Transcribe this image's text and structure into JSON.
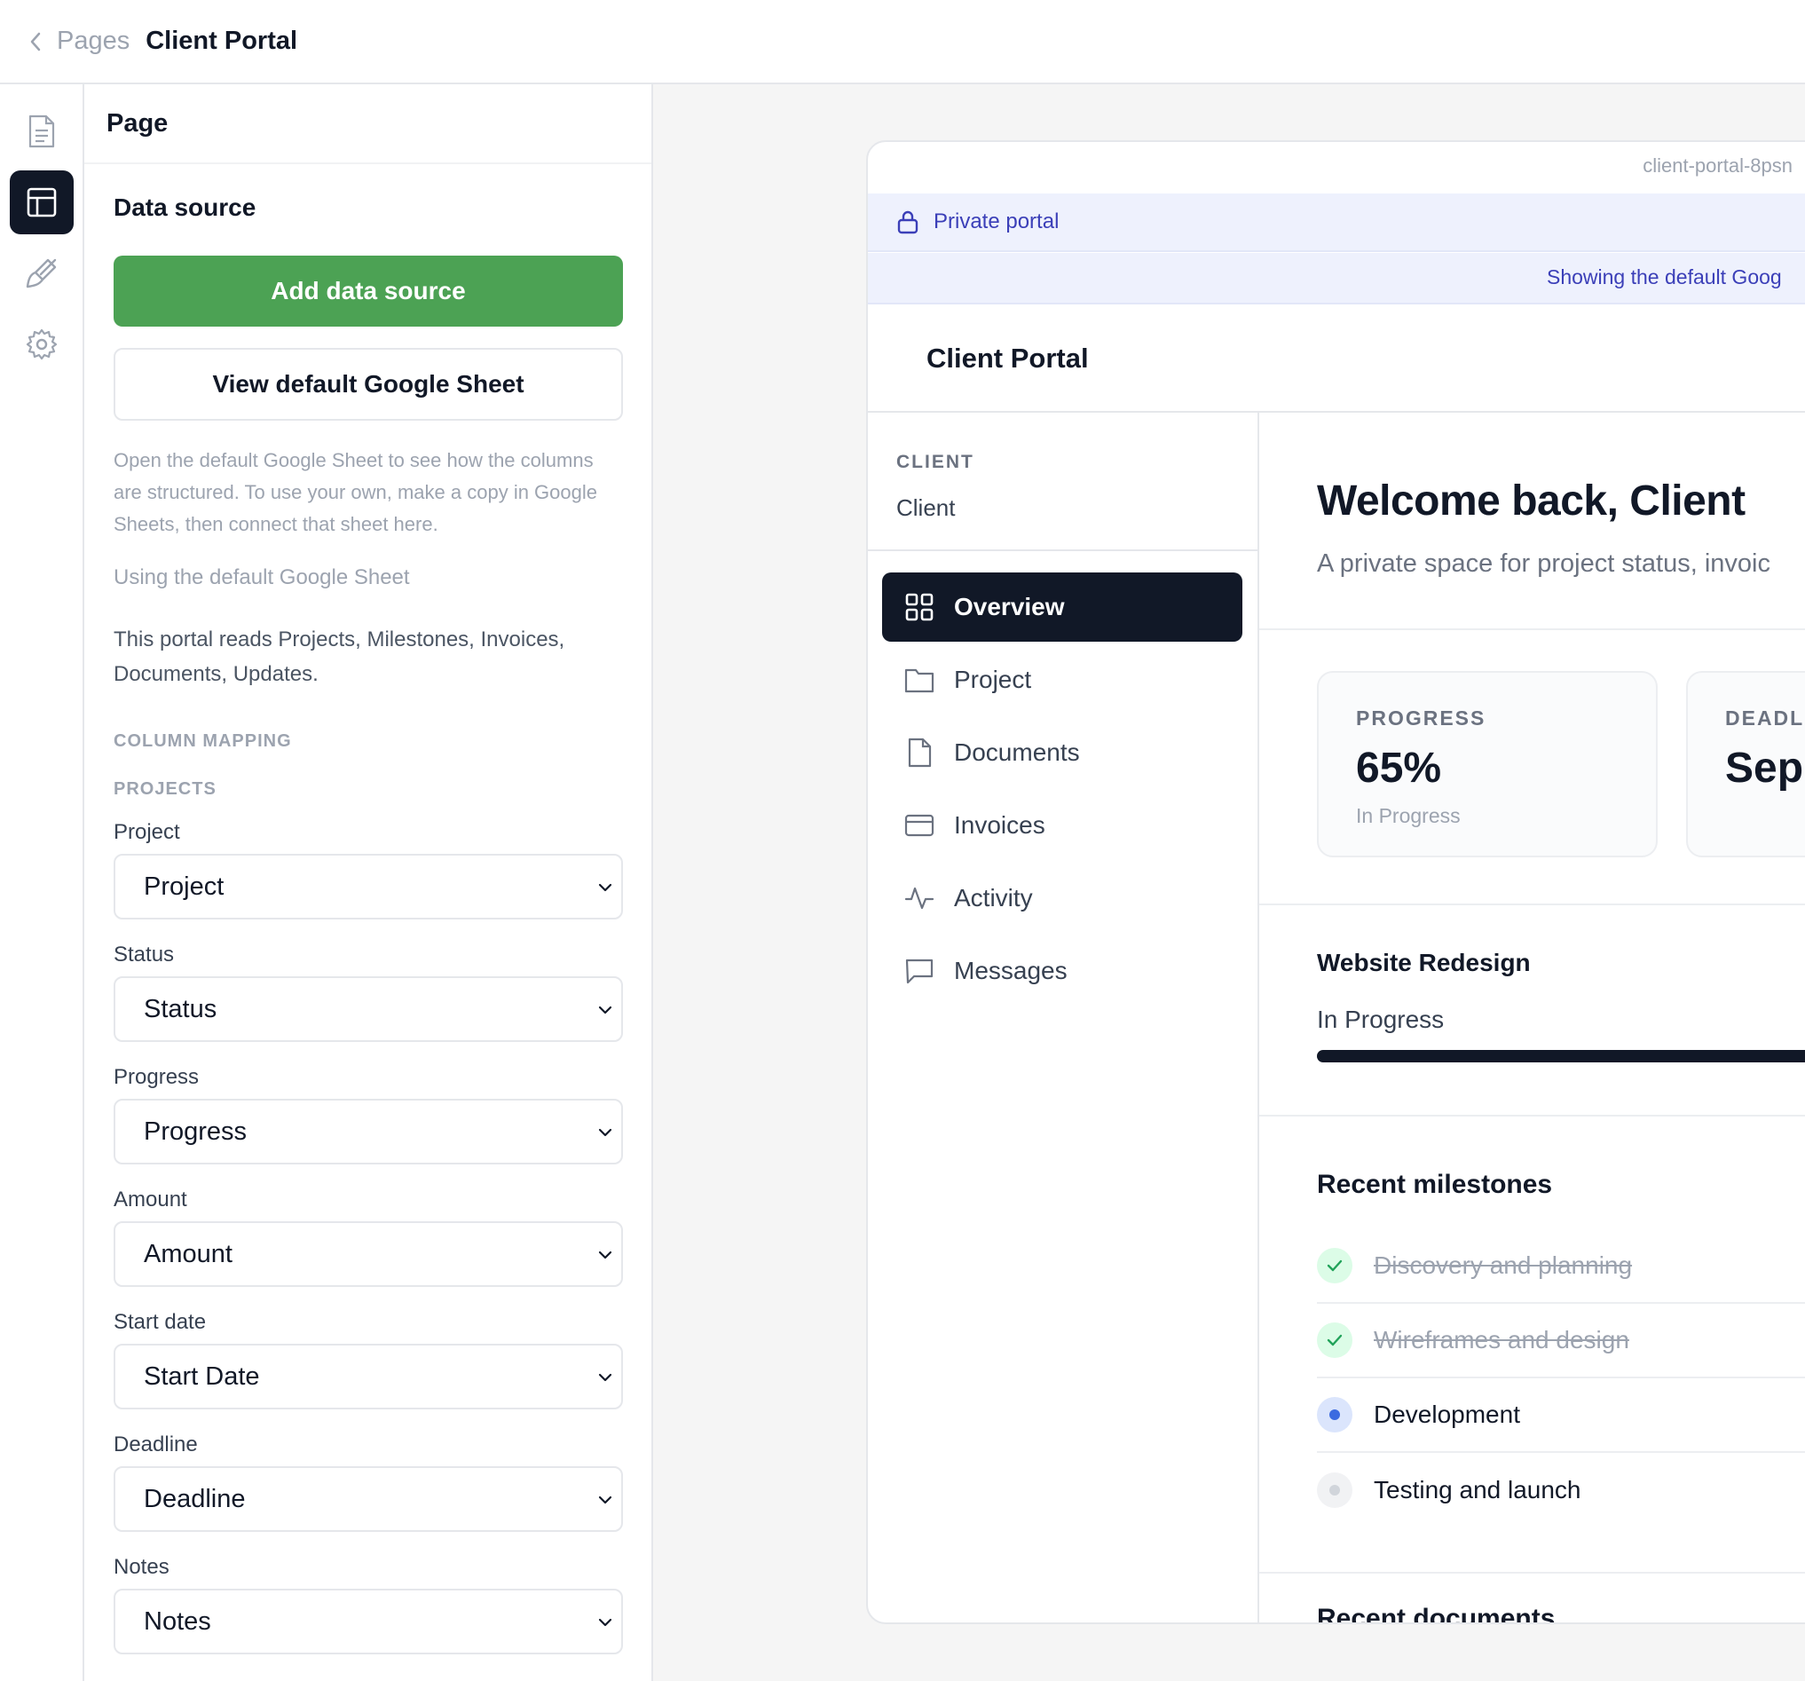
{
  "topbar": {
    "crumb": "Pages",
    "title": "Client Portal"
  },
  "rail": {
    "items": [
      "page-icon",
      "layout-icon",
      "brush-icon",
      "gear-icon"
    ],
    "active": 1
  },
  "panel": {
    "title": "Page",
    "section_title": "Data source",
    "add_button": "Add data source",
    "view_button": "View default Google Sheet",
    "help": "Open the default Google Sheet to see how the columns are structured. To use your own, make a copy in Google Sheets, then connect that sheet here.",
    "using": "Using the default Google Sheet",
    "reads": "This portal reads Projects, Milestones, Invoices, Documents, Updates.",
    "column_mapping": "COLUMN MAPPING",
    "projects_heading": "PROJECTS",
    "fields": [
      {
        "label": "Project",
        "value": "Project"
      },
      {
        "label": "Status",
        "value": "Status"
      },
      {
        "label": "Progress",
        "value": "Progress"
      },
      {
        "label": "Amount",
        "value": "Amount"
      },
      {
        "label": "Start date",
        "value": "Start Date"
      },
      {
        "label": "Deadline",
        "value": "Deadline"
      },
      {
        "label": "Notes",
        "value": "Notes"
      }
    ]
  },
  "preview": {
    "slug": "client-portal-8psn",
    "private_label": "Private portal",
    "info": "Showing the default Goog",
    "header_title": "Client Portal",
    "client_caption": "CLIENT",
    "client_value": "Client",
    "nav": [
      {
        "label": "Overview",
        "icon": "grid-icon"
      },
      {
        "label": "Project",
        "icon": "folder-icon"
      },
      {
        "label": "Documents",
        "icon": "document-icon"
      },
      {
        "label": "Invoices",
        "icon": "card-icon"
      },
      {
        "label": "Activity",
        "icon": "activity-icon"
      },
      {
        "label": "Messages",
        "icon": "message-icon"
      }
    ],
    "welcome": "Welcome back, Client",
    "subtitle": "A private space for project status, invoic",
    "cards": [
      {
        "caption": "PROGRESS",
        "value": "65%",
        "note": "In Progress"
      },
      {
        "caption": "DEADLI",
        "value": "Sep",
        "note": ""
      }
    ],
    "project_title": "Website Redesign",
    "project_status": "In Progress",
    "milestones_title": "Recent milestones",
    "milestones": [
      {
        "label": "Discovery and planning",
        "state": "done"
      },
      {
        "label": "Wireframes and design",
        "state": "done"
      },
      {
        "label": "Development",
        "state": "current"
      },
      {
        "label": "Testing and launch",
        "state": "upcoming"
      }
    ],
    "documents_title": "Recent documents",
    "colors": {
      "accent_green": "#4ca254",
      "dark": "#111827",
      "portal_blue": "#3b3fb8"
    }
  }
}
